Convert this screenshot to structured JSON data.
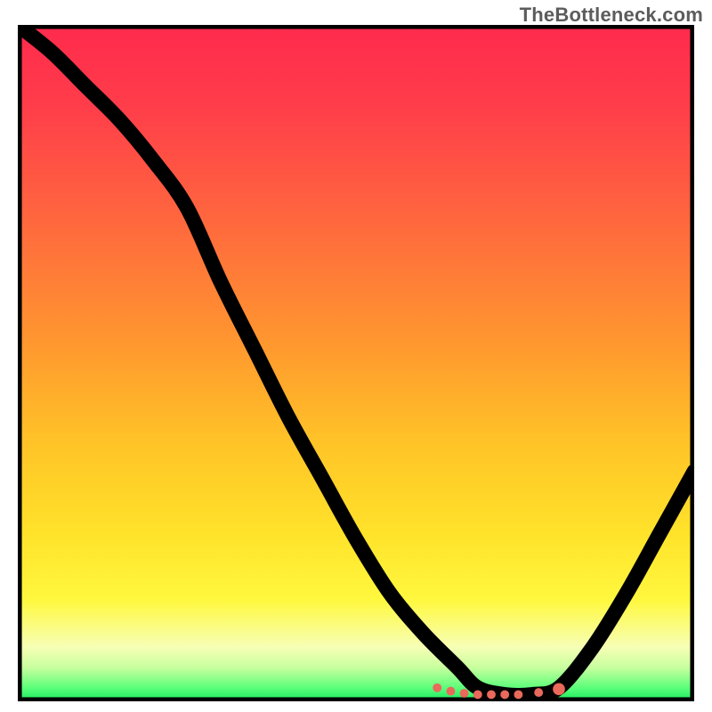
{
  "watermark": "TheBottleneck.com",
  "colors": {
    "curve": "#000000",
    "dots": "#e9695a",
    "gradient_top": "#ff2a4d",
    "gradient_bottom": "#15e85f"
  },
  "chart_data": {
    "type": "line",
    "title": "",
    "xlabel": "",
    "ylabel": "",
    "xlim": [
      0,
      100
    ],
    "ylim": [
      0,
      100
    ],
    "note": "x is normalized score (0=left,100=right); y is bottleneck percentage (0=bottom/green optimal, 100=top/red worst). Values estimated from pixel positions.",
    "x": [
      0,
      5,
      10,
      15,
      20,
      25,
      30,
      35,
      40,
      45,
      50,
      55,
      60,
      65,
      68,
      72,
      76,
      80,
      85,
      90,
      95,
      100
    ],
    "y": [
      100,
      96,
      91,
      86,
      80,
      73,
      62,
      52,
      42,
      33,
      24,
      16,
      10,
      5,
      2,
      1,
      1,
      2,
      8,
      16,
      25,
      34
    ],
    "optimal_dots_x": [
      62,
      64,
      66,
      68,
      70,
      72,
      74,
      77,
      80
    ],
    "optimal_dots_y": [
      2,
      1.5,
      1.2,
      1,
      1,
      1,
      1,
      1.3,
      1.8
    ]
  }
}
